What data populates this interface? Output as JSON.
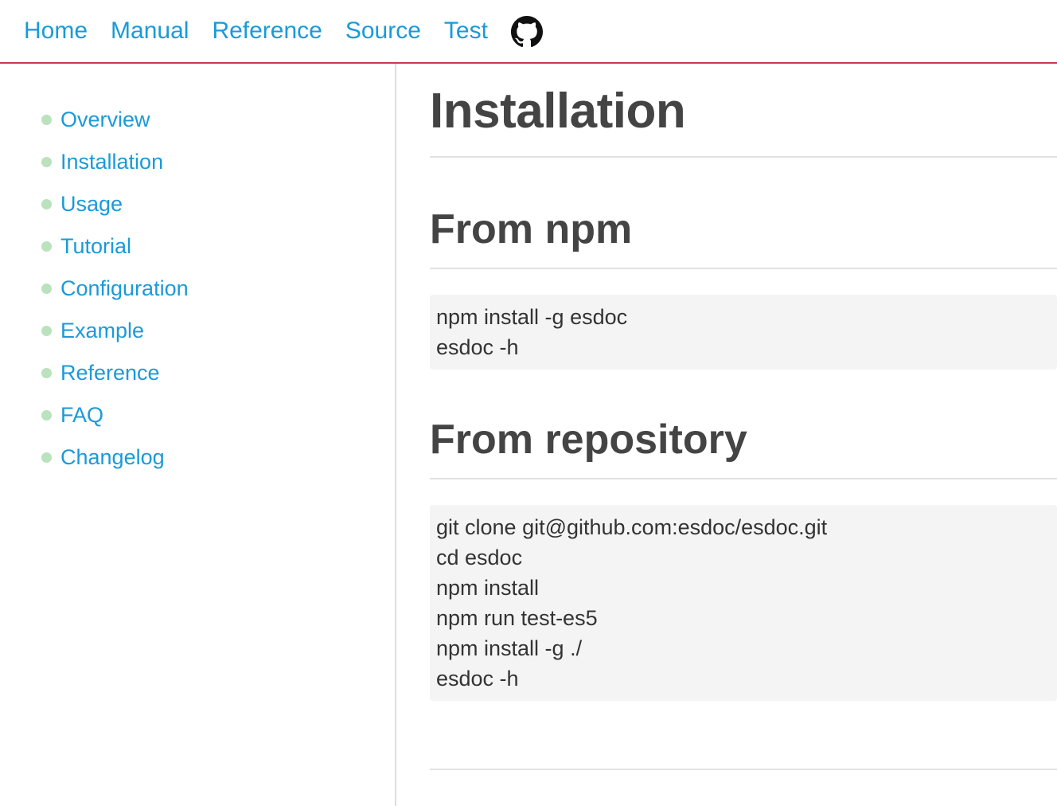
{
  "nav": {
    "links": [
      "Home",
      "Manual",
      "Reference",
      "Source",
      "Test"
    ],
    "github_icon": "github-icon"
  },
  "sidebar": {
    "items": [
      {
        "label": "Overview"
      },
      {
        "label": "Installation"
      },
      {
        "label": "Usage"
      },
      {
        "label": "Tutorial"
      },
      {
        "label": "Configuration"
      },
      {
        "label": "Example"
      },
      {
        "label": "Reference"
      },
      {
        "label": "FAQ"
      },
      {
        "label": "Changelog"
      }
    ]
  },
  "main": {
    "title": "Installation",
    "sections": [
      {
        "heading": "From npm",
        "code": [
          "npm install -g esdoc",
          "esdoc -h"
        ]
      },
      {
        "heading": "From repository",
        "code": [
          "git clone git@github.com:esdoc/esdoc.git",
          "cd esdoc",
          "npm install",
          "npm run test-es5",
          "npm install -g ./",
          "esdoc -h"
        ]
      }
    ]
  },
  "colors": {
    "link": "#1a9ad9",
    "nav_border": "#d0384a",
    "bullet": "#b9e2bd",
    "heading": "#444444",
    "code_bg": "#f4f4f4"
  }
}
